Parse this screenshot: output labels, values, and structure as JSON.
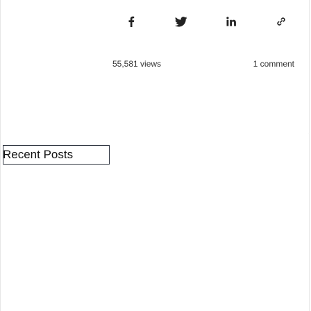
{
  "post": {
    "share": {
      "icons": [
        "facebook-icon",
        "twitter-icon",
        "linkedin-icon",
        "link-icon"
      ]
    },
    "views": "55,581 views",
    "comments": "1 comment"
  },
  "sidebar": {
    "widget_title": "Recent Posts"
  },
  "colors": {
    "icon": "#222222",
    "border": "#e6e6e6",
    "title_border": "#2f3540"
  }
}
